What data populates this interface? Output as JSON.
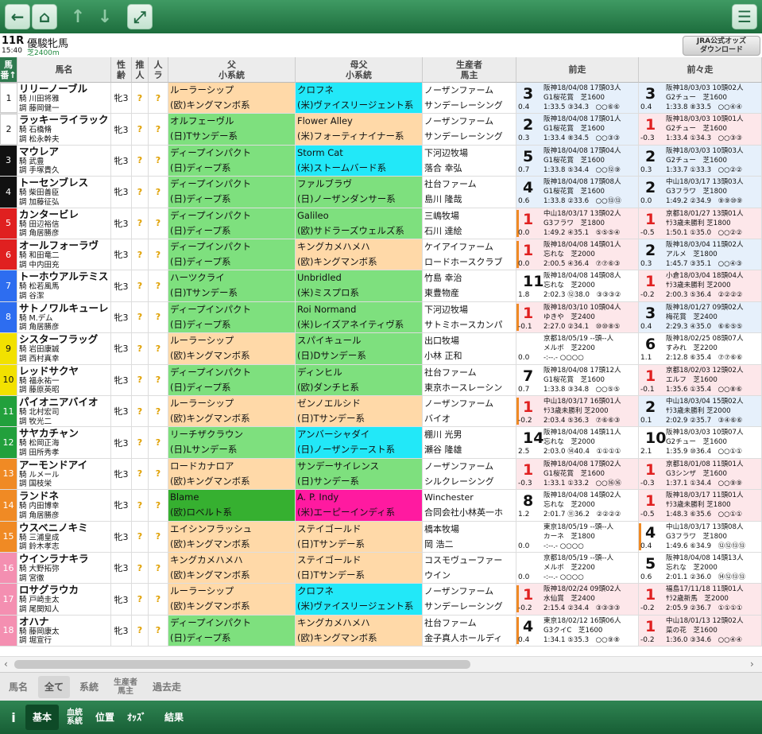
{
  "toolbar": {
    "back": "←",
    "home": "⌂",
    "up": "↑",
    "down": "↓",
    "expand": "⤢",
    "menu": "☰"
  },
  "race": {
    "number": "11R",
    "name": "優駿牝馬",
    "time": "15:40",
    "distance": "芝2400m"
  },
  "odds_button": {
    "line1": "JRA公式オッズ",
    "line2": "ダウンロード"
  },
  "headers": {
    "num": "馬\n番↑",
    "name": "馬名",
    "sexage": "性\n齢",
    "rec": "推\n人",
    "pop": "人\nラ",
    "sire": "父\n小系統",
    "damsire": "母父\n小系統",
    "breeder": "生産者\n馬主",
    "prev1": "前走",
    "prev2": "前々走"
  },
  "horses": [
    {
      "no": "1",
      "wc": 0,
      "name": "リリーノーブル",
      "j": "騎 川田将雅",
      "t": "調 藤岡健一",
      "sa": "牝3",
      "q1": "?",
      "q2": "?",
      "sire": "ルーラーシップ",
      "sl": "(欧)キングマンボ系",
      "sc": "o",
      "dam": "クロフネ",
      "dl": "(米)ヴァイスリージェント系",
      "dc": "cy",
      "br": "ノーザンファーム",
      "ow": "サンデーレーシング",
      "p1": {
        "pos": "3",
        "diff": "0.4",
        "l1": "阪神18/04/08 17頭03人",
        "l2": "G1桜花賞　芝1600",
        "l3": "1:33.5 ③34.3　○○⑥⑥",
        "bg": "bu"
      },
      "p2": {
        "pos": "3",
        "diff": "0.4",
        "l1": "阪神18/03/03 10頭02人",
        "l2": "G2チュー　芝1600",
        "l3": "1:33.8 ⑧33.5　○○④④",
        "bg": "bu"
      }
    },
    {
      "no": "2",
      "wc": 0,
      "name": "ラッキーライラック",
      "j": "騎 石橋脩",
      "t": "調 松永幹夫",
      "sa": "牝3",
      "q1": "?",
      "q2": "?",
      "sire": "オルフェーヴル",
      "sl": "(日)Tサンデー系",
      "sc": "g",
      "dam": "Flower Alley",
      "dl": "(米)フォーティナイナー系",
      "dc": "o",
      "br": "ノーザンファーム",
      "ow": "サンデーレーシング",
      "p1": {
        "pos": "2",
        "diff": "0.3",
        "l1": "阪神18/04/08 17頭01人",
        "l2": "G1桜花賞　芝1600",
        "l3": "1:33.4 ⑧34.5　○○③③",
        "bg": "bu"
      },
      "p2": {
        "pos": "1",
        "diff": "-0.3",
        "l1": "阪神18/03/03 10頭01人",
        "l2": "G2チュー　芝1600",
        "l3": "1:33.4 ①34.3　○○③③",
        "bg": "pk"
      }
    },
    {
      "no": "3",
      "wc": 1,
      "name": "マウレア",
      "j": "騎 武豊",
      "t": "調 手塚貴久",
      "sa": "牝3",
      "q1": "?",
      "q2": "?",
      "sire": "ディープインパクト",
      "sl": "(日)ディープ系",
      "sc": "g",
      "dam": "Storm Cat",
      "dl": "(米)ストームバード系",
      "dc": "cy",
      "br": "下河辺牧場",
      "ow": "落合 幸弘",
      "p1": {
        "pos": "5",
        "diff": "0.7",
        "l1": "阪神18/04/08 17頭04人",
        "l2": "G1桜花賞　芝1600",
        "l3": "1:33.8 ⑤34.4　○○⑫⑨",
        "bg": "bu"
      },
      "p2": {
        "pos": "2",
        "diff": "0.3",
        "l1": "阪神18/03/03 10頭03人",
        "l2": "G2チュー　芝1600",
        "l3": "1:33.7 ①33.3　○○②②",
        "bg": "bu"
      }
    },
    {
      "no": "4",
      "wc": 1,
      "name": "トーセンブレス",
      "j": "騎 柴田善臣",
      "t": "調 加藤征弘",
      "sa": "牝3",
      "q1": "?",
      "q2": "?",
      "sire": "ディープインパクト",
      "sl": "(日)ディープ系",
      "sc": "g",
      "dam": "ファルブラヴ",
      "dl": "(日)ノーザンダンサー系",
      "dc": "g",
      "br": "社台ファーム",
      "ow": "島川 隆哉",
      "p1": {
        "pos": "4",
        "diff": "0.6",
        "l1": "阪神18/04/08 17頭08人",
        "l2": "G1桜花賞　芝1600",
        "l3": "1:33.8 ②33.6　○○⑬⑬",
        "bg": "bu"
      },
      "p2": {
        "pos": "2",
        "diff": "0.0",
        "l1": "中山18/03/17 13頭03人",
        "l2": "G3フラワ　芝1800",
        "l3": "1:49.2 ②34.9　⑨⑨⑩⑨",
        "bg": "bu"
      }
    },
    {
      "no": "5",
      "wc": 2,
      "name": "カンタービレ",
      "j": "騎 田辺裕信",
      "t": "調 角居勝彦",
      "sa": "牝3",
      "q1": "?",
      "q2": "?",
      "sire": "ディープインパクト",
      "sl": "(日)ディープ系",
      "sc": "g",
      "dam": "Galileo",
      "dl": "(欧)サドラーズウェルズ系",
      "dc": "g",
      "br": "三嶋牧場",
      "ow": "石川 達絵",
      "p1": {
        "pos": "1",
        "diff": "0.0",
        "l1": "中山18/03/17 13頭02人",
        "l2": "G3フラワ　芝1800",
        "l3": "1:49.2 ④35.1　⑤⑤⑤④",
        "bg": "pk",
        "bar": true
      },
      "p2": {
        "pos": "1",
        "diff": "-0.5",
        "l1": "京都18/01/27 13頭01人",
        "l2": "ｻﾗ3歳未勝利 芝1800",
        "l3": "1:50.1 ①35.0　○○②②",
        "bg": "pk"
      }
    },
    {
      "no": "6",
      "wc": 2,
      "name": "オールフォーラヴ",
      "j": "騎 和田竜二",
      "t": "調 中内田充",
      "sa": "牝3",
      "q1": "?",
      "q2": "?",
      "sire": "ディープインパクト",
      "sl": "(日)ディープ系",
      "sc": "g",
      "dam": "キングカメハメハ",
      "dl": "(欧)キングマンボ系",
      "dc": "o",
      "br": "ケイアイファーム",
      "ow": "ロードホースクラブ",
      "p1": {
        "pos": "1",
        "diff": "0.0",
        "l1": "阪神18/04/08 14頭01人",
        "l2": "忘れな　芝2000",
        "l3": "2:00.5 ④36.4　⑦⑦⑥③",
        "bg": "pk",
        "bar": true
      },
      "p2": {
        "pos": "2",
        "diff": "0.3",
        "l1": "阪神18/03/04 11頭02人",
        "l2": "アルメ　芝1800",
        "l3": "1:45.7 ③35.1　○○④③",
        "bg": "bu"
      }
    },
    {
      "no": "7",
      "wc": 3,
      "name": "トーホウアルテミス",
      "j": "騎 松若風馬",
      "t": "調 谷潔",
      "sa": "牝3",
      "q1": "?",
      "q2": "?",
      "sire": "ハーツクライ",
      "sl": "(日)Tサンデー系",
      "sc": "g",
      "dam": "Unbridled",
      "dl": "(米)ミスプロ系",
      "dc": "g",
      "br": "竹島 幸治",
      "ow": "東豊物産",
      "p1": {
        "pos": "11",
        "diff": "1.8",
        "l1": "阪神18/04/08 14頭08人",
        "l2": "忘れな　芝2000",
        "l3": "2:02.3 ⑫38.0　③③③②",
        "bg": "w"
      },
      "p2": {
        "pos": "1",
        "diff": "-0.2",
        "l1": "小倉18/03/04 18頭04人",
        "l2": "ｻﾗ3歳未勝利 芝2000",
        "l3": "2:00.3 ⑤36.4　②②②②",
        "bg": "pk"
      }
    },
    {
      "no": "8",
      "wc": 3,
      "name": "サトノワルキューレ",
      "j": "騎 M.デム",
      "t": "調 角居勝彦",
      "sa": "牝3",
      "q1": "?",
      "q2": "?",
      "sire": "ディープインパクト",
      "sl": "(日)ディープ系",
      "sc": "g",
      "dam": "Roi Normand",
      "dl": "(米)レイズアネイティヴ系",
      "dc": "g",
      "br": "下河辺牧場",
      "ow": "サトミホースカンパ",
      "p1": {
        "pos": "1",
        "diff": "-0.1",
        "l1": "阪神18/03/10 10頭04人",
        "l2": "ゆきや　芝2400",
        "l3": "2:27.0 ②34.1　⑩⑩⑧⑤",
        "bg": "pk",
        "bar": true
      },
      "p2": {
        "pos": "3",
        "diff": "0.4",
        "l1": "阪神18/01/27 09頭02人",
        "l2": "梅花賞　芝2400",
        "l3": "2:29.3 ④35.0　⑥⑥⑤⑤",
        "bg": "bu"
      }
    },
    {
      "no": "9",
      "wc": 4,
      "name": "シスターフラッグ",
      "j": "騎 岩田康誠",
      "t": "調 西村真幸",
      "sa": "牝3",
      "q1": "?",
      "q2": "?",
      "sire": "ルーラーシップ",
      "sl": "(欧)キングマンボ系",
      "sc": "o",
      "dam": "スパイキュール",
      "dl": "(日)Dサンデー系",
      "dc": "g",
      "br": "出口牧場",
      "ow": "小林 正和",
      "p1": {
        "pos": "",
        "diff": "0.0",
        "l1": "京都18/05/19 --頭--人",
        "l2": "メルボ　芝2200",
        "l3": "-:--.- ○○○○",
        "bg": "w"
      },
      "p2": {
        "pos": "6",
        "diff": "1.1",
        "l1": "阪神18/02/25 08頭07人",
        "l2": "すみれ　芝2200",
        "l3": "2:12.8 ⑥35.4　⑦⑦⑥⑥",
        "bg": "w"
      }
    },
    {
      "no": "10",
      "wc": 4,
      "name": "レッドサクヤ",
      "j": "騎 福永祐一",
      "t": "調 藤原英昭",
      "sa": "牝3",
      "q1": "?",
      "q2": "?",
      "sire": "ディープインパクト",
      "sl": "(日)ディープ系",
      "sc": "g",
      "dam": "ディンヒル",
      "dl": "(欧)ダンチヒ系",
      "dc": "g",
      "br": "社台ファーム",
      "ow": "東京ホースレーシン",
      "p1": {
        "pos": "7",
        "diff": "0.7",
        "l1": "阪神18/04/08 17頭12人",
        "l2": "G1桜花賞　芝1600",
        "l3": "1:33.8 ③34.8　○○⑤⑤",
        "bg": "w"
      },
      "p2": {
        "pos": "1",
        "diff": "-0.1",
        "l1": "京都18/02/03 12頭02人",
        "l2": "エルフ　芝1600",
        "l3": "1:35.6 ①35.4　○○⑧⑥",
        "bg": "pk"
      }
    },
    {
      "no": "11",
      "wc": 5,
      "name": "パイオニアバイオ",
      "j": "騎 北村宏司",
      "t": "調 牧光二",
      "sa": "牝3",
      "q1": "?",
      "q2": "?",
      "sire": "ルーラーシップ",
      "sl": "(欧)キングマンボ系",
      "sc": "o",
      "dam": "ゼンノエルシド",
      "dl": "(日)Tサンデー系",
      "dc": "o",
      "br": "ノーザンファーム",
      "ow": "バイオ",
      "p1": {
        "pos": "1",
        "diff": "-0.2",
        "l1": "中山18/03/17 16頭01人",
        "l2": "ｻﾗ3歳未勝利 芝2000",
        "l3": "2:03.4 ⑤36.3　⑦⑥⑥③",
        "bg": "pk",
        "bar": true
      },
      "p2": {
        "pos": "2",
        "diff": "0.1",
        "l1": "中山18/03/04 15頭02人",
        "l2": "ｻﾗ3歳未勝利 芝2000",
        "l3": "2:02.9 ②35.7　③④⑥⑥",
        "bg": "bu"
      }
    },
    {
      "no": "12",
      "wc": 5,
      "name": "サヤカチャン",
      "j": "騎 松岡正海",
      "t": "調 田所秀孝",
      "sa": "牝3",
      "q1": "?",
      "q2": "?",
      "sire": "リーチザクラウン",
      "sl": "(日)Lサンデー系",
      "sc": "g",
      "dam": "アンバーシャダイ",
      "dl": "(日)ノーザンテースト系",
      "dc": "cy",
      "br": "棚川 光男",
      "ow": "瀬谷 隆雄",
      "p1": {
        "pos": "14",
        "diff": "2.5",
        "l1": "阪神18/04/08 14頭11人",
        "l2": "忘れな　芝2000",
        "l3": "2:03.0 ⑭40.4　①①①①",
        "bg": "w"
      },
      "p2": {
        "pos": "10",
        "diff": "2.1",
        "l1": "阪神18/03/03 10頭07人",
        "l2": "G2チュー　芝1600",
        "l3": "1:35.9 ⑩36.4　○○①①",
        "bg": "w"
      }
    },
    {
      "no": "13",
      "wc": 6,
      "name": "アーモンドアイ",
      "j": "騎 ルメール",
      "t": "調 国枝栄",
      "sa": "牝3",
      "q1": "?",
      "q2": "?",
      "sire": "ロードカナロア",
      "sl": "(欧)キングマンボ系",
      "sc": "o",
      "dam": "サンデーサイレンス",
      "dl": "(日)サンデー系",
      "dc": "g",
      "br": "ノーザンファーム",
      "ow": "シルクレーシング",
      "p1": {
        "pos": "1",
        "diff": "-0.3",
        "l1": "阪神18/04/08 17頭02人",
        "l2": "G1桜花賞　芝1600",
        "l3": "1:33.1 ①33.2　○○⑯⑯",
        "bg": "pk"
      },
      "p2": {
        "pos": "1",
        "diff": "-0.3",
        "l1": "京都18/01/08 11頭01人",
        "l2": "G3シンザ　芝1600",
        "l3": "1:37.1 ①34.4　○○⑨⑨",
        "bg": "pk"
      }
    },
    {
      "no": "14",
      "wc": 6,
      "name": "ランドネ",
      "j": "騎 内田博幸",
      "t": "調 角居勝彦",
      "sa": "牝3",
      "q1": "?",
      "q2": "?",
      "sire": "Blame",
      "sl": "(欧)ロベルト系",
      "sc": "dg",
      "dam": "A. P. Indy",
      "dl": "(米)エーピーインディ系",
      "dc": "m",
      "br": "Winchester",
      "ow": "合同会社小林英一ホ",
      "p1": {
        "pos": "8",
        "diff": "1.2",
        "l1": "阪神18/04/08 14頭02人",
        "l2": "忘れな　芝2000",
        "l3": "2:01.7 ⑪36.2　②②②②",
        "bg": "w"
      },
      "p2": {
        "pos": "1",
        "diff": "-0.5",
        "l1": "阪神18/03/17 11頭01人",
        "l2": "ｻﾗ3歳未勝利 芝1800",
        "l3": "1:48.3 ⑥35.6　○○①①",
        "bg": "pk"
      }
    },
    {
      "no": "15",
      "wc": 6,
      "name": "ウスベニノキミ",
      "j": "騎 三浦皇成",
      "t": "調 鈴木孝志",
      "sa": "牝3",
      "q1": "?",
      "q2": "?",
      "sire": "エイシンフラッシュ",
      "sl": "(欧)キングマンボ系",
      "sc": "o",
      "dam": "ステイゴールド",
      "dl": "(日)Tサンデー系",
      "dc": "o",
      "br": "橋本牧場",
      "ow": "岡 浩二",
      "p1": {
        "pos": "",
        "diff": "0.0",
        "l1": "東京18/05/19 --頭--人",
        "l2": "カーネ　芝1800",
        "l3": "-:--.- ○○○○",
        "bg": "w"
      },
      "p2": {
        "pos": "4",
        "diff": "0.4",
        "l1": "中山18/03/17 13頭08人",
        "l2": "G3フラワ　芝1800",
        "l3": "1:49.6 ⑥34.9　⑫⑫⑬⑬",
        "bg": "w",
        "bar": true
      }
    },
    {
      "no": "16",
      "wc": 7,
      "name": "ウインラナキラ",
      "j": "騎 大野拓弥",
      "t": "調 宮徹",
      "sa": "牝3",
      "q1": "?",
      "q2": "?",
      "sire": "キングカメハメハ",
      "sl": "(欧)キングマンボ系",
      "sc": "o",
      "dam": "ステイゴールド",
      "dl": "(日)Tサンデー系",
      "dc": "o",
      "br": "コスモヴューファー",
      "ow": "ウイン",
      "p1": {
        "pos": "",
        "diff": "0.0",
        "l1": "京都18/05/19 --頭--人",
        "l2": "メルボ　芝2200",
        "l3": "-:--.- ○○○○",
        "bg": "w"
      },
      "p2": {
        "pos": "5",
        "diff": "0.6",
        "l1": "阪神18/04/08 14頭13人",
        "l2": "忘れな　芝2000",
        "l3": "2:01.1 ②36.0　⑭⑫⑬⑬",
        "bg": "w"
      }
    },
    {
      "no": "17",
      "wc": 7,
      "name": "ロサグラウカ",
      "j": "騎 戸崎圭太",
      "t": "調 尾関知人",
      "sa": "牝3",
      "q1": "?",
      "q2": "?",
      "sire": "ルーラーシップ",
      "sl": "(欧)キングマンボ系",
      "sc": "o",
      "dam": "クロフネ",
      "dl": "(米)ヴァイスリージェント系",
      "dc": "cy",
      "br": "ノーザンファーム",
      "ow": "サンデーレーシング",
      "p1": {
        "pos": "1",
        "diff": "-0.2",
        "l1": "阪神18/02/24 09頭02人",
        "l2": "水仙賞　芝2400",
        "l3": "2:15.4 ②34.4　③③③③",
        "bg": "pk",
        "bar": true
      },
      "p2": {
        "pos": "1",
        "diff": "-0.2",
        "l1": "福島17/11/18 11頭01人",
        "l2": "ｻﾗ2歳新馬　芝2000",
        "l3": "2:05.9 ②36.7　①①①①",
        "bg": "pk"
      }
    },
    {
      "no": "18",
      "wc": 7,
      "name": "オハナ",
      "j": "騎 藤岡康太",
      "t": "調 堀宣行",
      "sa": "牝3",
      "q1": "?",
      "q2": "?",
      "sire": "ディープインパクト",
      "sl": "(日)ディープ系",
      "sc": "g",
      "dam": "キングカメハメハ",
      "dl": "(欧)キングマンボ系",
      "dc": "o",
      "br": "社台ファーム",
      "ow": "金子真人ホールディ",
      "p1": {
        "pos": "4",
        "diff": "0.4",
        "l1": "東京18/02/12 16頭06人",
        "l2": "G3クイC　芝1600",
        "l3": "1:34.1 ⑤35.3　○○⑨⑧",
        "bg": "w",
        "bar": true
      },
      "p2": {
        "pos": "1",
        "diff": "-0.2",
        "l1": "中山18/01/13 12頭02人",
        "l2": "菜の花　芝1600",
        "l3": "1:36.0 ③34.6　○○④④",
        "bg": "pk"
      }
    }
  ],
  "tabs": {
    "horse": "馬名",
    "all": "全て",
    "lineage": "系統",
    "breeder": "生産者\n馬主",
    "past": "過去走"
  },
  "bottom": {
    "info": "i",
    "basic": "基本",
    "blood": "血統\n系統",
    "pos": "位置",
    "odds": "ｵｯｽﾞ",
    "result": "結果"
  }
}
